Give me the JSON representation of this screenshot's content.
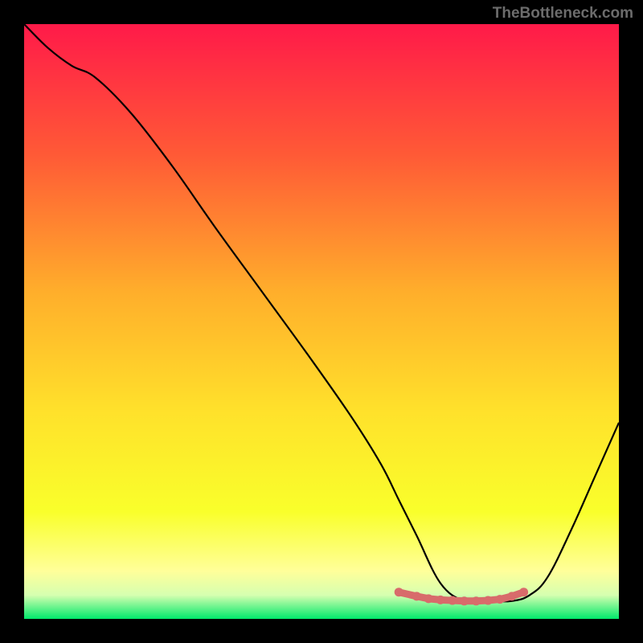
{
  "watermark": "TheBottleneck.com",
  "chart_data": {
    "type": "line",
    "title": "",
    "xlabel": "",
    "ylabel": "",
    "xlim": [
      0,
      100
    ],
    "ylim": [
      0,
      100
    ],
    "background_gradient": {
      "top": "#ff1a49",
      "upper_mid": "#ff7a2b",
      "mid": "#ffd92b",
      "lower_mid": "#f7ff2b",
      "lower": "#ffff8f",
      "bottom": "#00e86b"
    },
    "series": [
      {
        "name": "curve",
        "color": "#000000",
        "x": [
          0,
          4,
          8,
          12,
          18,
          25,
          32,
          40,
          48,
          55,
          60,
          63,
          66,
          70,
          74,
          78,
          82,
          85,
          88,
          92,
          96,
          100
        ],
        "y": [
          100,
          96,
          93,
          91,
          85,
          76,
          66,
          55,
          44,
          34,
          26,
          20,
          14,
          6,
          3,
          3,
          3,
          4,
          7,
          15,
          24,
          33
        ]
      },
      {
        "name": "bottom-markers",
        "color": "#d86b6b",
        "type": "marker-line",
        "x": [
          63,
          66,
          68,
          70,
          72,
          74,
          76,
          78,
          80,
          82,
          84
        ],
        "y": [
          4.5,
          3.8,
          3.4,
          3.2,
          3.1,
          3.0,
          3.0,
          3.1,
          3.3,
          3.8,
          4.5
        ]
      }
    ]
  }
}
